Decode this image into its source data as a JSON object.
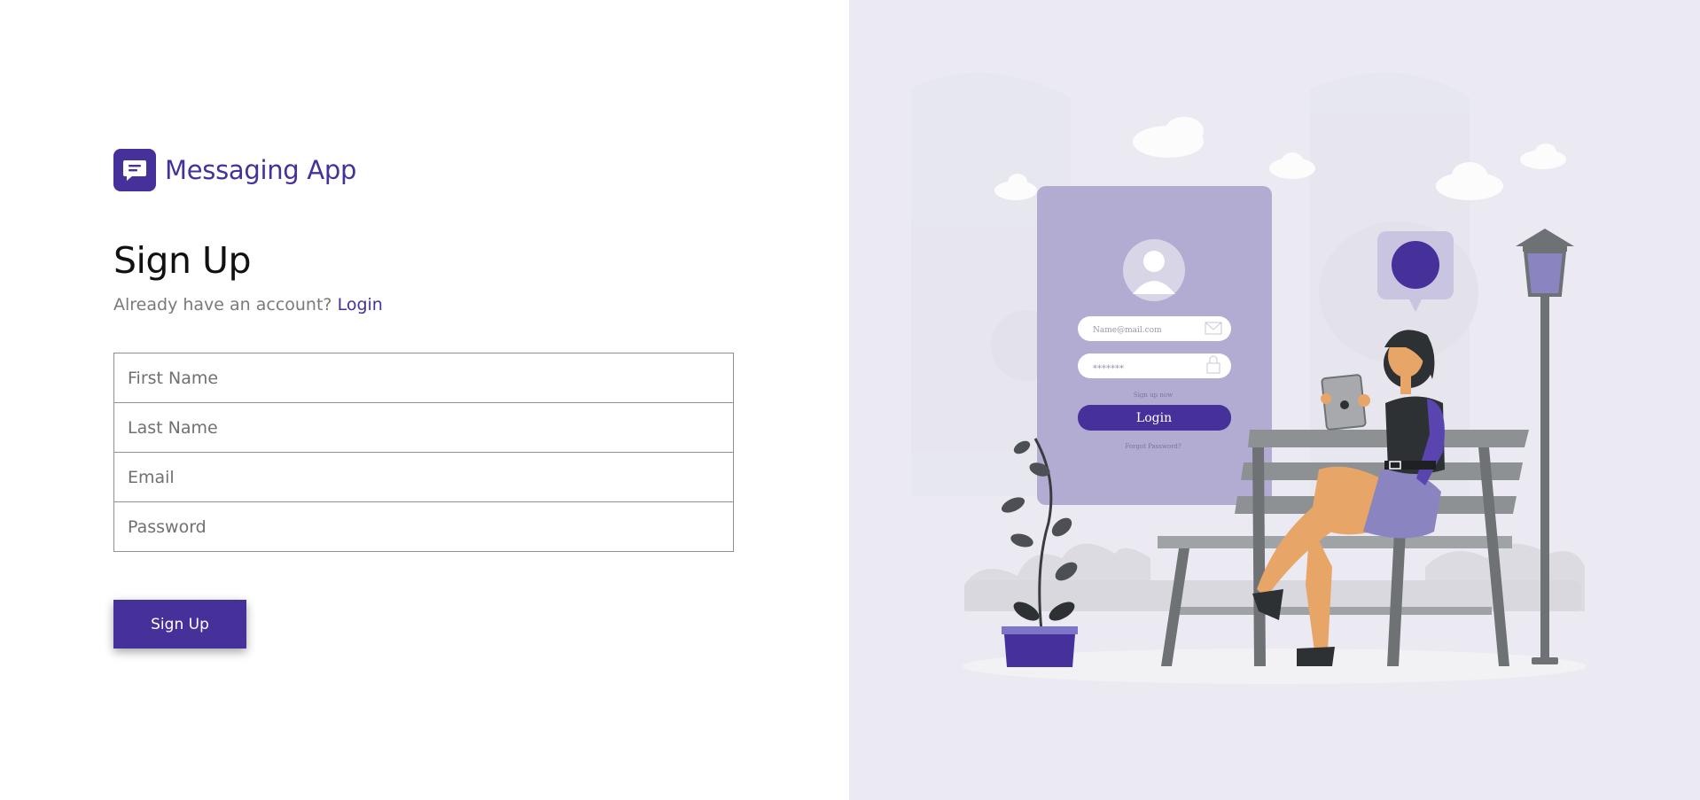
{
  "brand": {
    "name": "Messaging App",
    "logo_icon": "chat-bubble-icon"
  },
  "signup": {
    "title": "Sign Up",
    "prompt": "Already have an account?",
    "login_link": "Login",
    "fields": {
      "first_name": {
        "placeholder": "First Name",
        "value": ""
      },
      "last_name": {
        "placeholder": "Last Name",
        "value": ""
      },
      "email": {
        "placeholder": "Email",
        "value": ""
      },
      "password": {
        "placeholder": "Password",
        "value": ""
      }
    },
    "submit_label": "Sign Up"
  },
  "illustration": {
    "card_email_placeholder": "Name@mail.com",
    "card_password_mask": "*******",
    "card_signup_hint": "Sign up now",
    "card_login_button": "Login",
    "card_forgot": "Forgot Password?"
  },
  "colors": {
    "accent": "#46319b",
    "panel_background": "#ebeaf3",
    "card_background": "#b3acd2"
  }
}
